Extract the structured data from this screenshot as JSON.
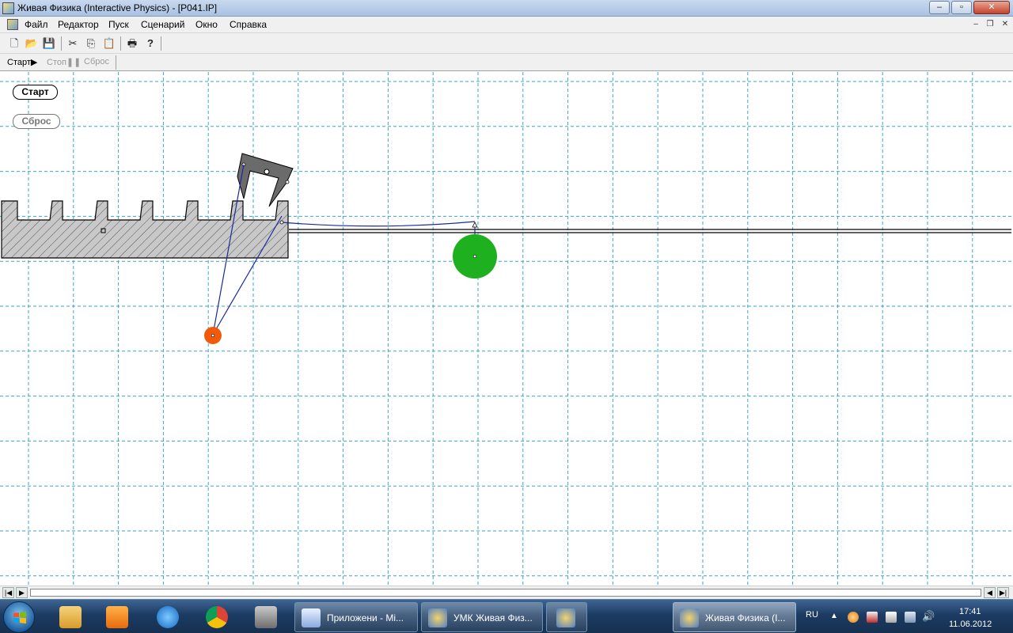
{
  "window": {
    "title": "Живая Физика (Interactive Physics) - [P041.IP]",
    "controls": {
      "minimize": "–",
      "maximize": "▫",
      "close": "✕"
    }
  },
  "menubar": {
    "items": [
      "Файл",
      "Редактор",
      "Пуск",
      "Сценарий",
      "Окно",
      "Справка"
    ],
    "mdi_controls": {
      "minimize": "–",
      "restore": "❐",
      "close": "✕"
    }
  },
  "toolbar": {
    "buttons": [
      {
        "name": "new-file-icon",
        "glyph": "🗋"
      },
      {
        "name": "open-folder-icon",
        "glyph": "📂"
      },
      {
        "name": "save-icon",
        "glyph": "💾"
      },
      {
        "name": "cut-icon",
        "glyph": "✂"
      },
      {
        "name": "copy-icon",
        "glyph": "⎘"
      },
      {
        "name": "paste-icon",
        "glyph": "📋"
      },
      {
        "name": "print-icon",
        "glyph": "🖶"
      },
      {
        "name": "help-icon",
        "glyph": "?"
      }
    ]
  },
  "runbar": {
    "start_label": "Старт▶",
    "stop_label": "Стоп❚❚",
    "reset_label": "Сброс"
  },
  "workspace": {
    "start_button": "Старт",
    "reset_button": "Сброс",
    "colors": {
      "grid": "#3aa6d0",
      "rack_fill": "#c8c8c8",
      "pawl_fill": "#6b6b6b",
      "rope": "#1a2a9c",
      "green_ball": "#1fb01f",
      "orange_ball": "#f05a0a"
    }
  },
  "taskbar": {
    "tasks": [
      {
        "label": "Приложени - Mi...",
        "icon": "word-icon"
      },
      {
        "label": "УМК Живая Физ...",
        "icon": "interactive-physics-icon"
      },
      {
        "label": "",
        "icon": "interactive-physics-icon"
      },
      {
        "label": "Живая Физика (I...",
        "icon": "interactive-physics-icon"
      }
    ],
    "pinned": [
      "explorer-icon",
      "media-player-icon",
      "internet-explorer-icon",
      "chrome-icon",
      "printer-icon"
    ],
    "tray": {
      "language": "RU",
      "time": "17:41",
      "date": "11.06.2012"
    }
  }
}
